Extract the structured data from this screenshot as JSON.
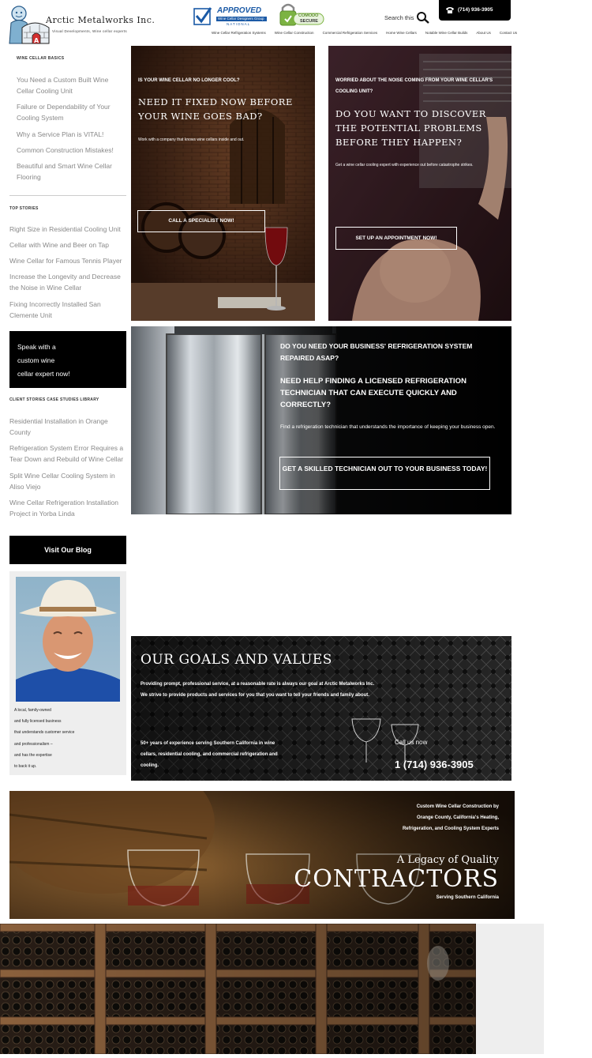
{
  "header": {
    "company_name": "Arctic Metalworks Inc.",
    "tagline": "Visual Developments, Wine cellar experts",
    "approved_badge": {
      "title": "APPROVED",
      "line1": "Wine Cellar Designers Group",
      "line2": "NATIONAL"
    },
    "secure_badge": {
      "line1": "COMODO",
      "line2": "SECURE"
    },
    "search_label": "Search this",
    "phone": "(714) 936-3905",
    "nav": [
      "Wine Cellar Refrigeration Systems",
      "Wine Cellar Construction",
      "Commercial Refrigeration Services",
      "Home Wine Cellars",
      "Notable Wine Cellar Builds",
      "About Us",
      "Contact Us"
    ]
  },
  "sidebar": {
    "basics_heading": "WINE CELLAR BASICS",
    "basics": [
      "You Need a Custom Built Wine Cellar Cooling Unit",
      "Failure or Dependability of Your Cooling System",
      "Why a Service Plan is VITAL!",
      "Common Construction Mistakes!",
      "Beautiful and Smart Wine Cellar Flooring"
    ],
    "top_heading": "TOP STORIES",
    "top": [
      "Right Size in Residential Cooling Unit",
      "Cellar with Wine and Beer on Tap",
      "Wine Cellar for Famous Tennis Player",
      "Increase the Longevity and Decrease the Noise in Wine Cellar",
      "Fixing Incorrectly Installed San Clemente Unit"
    ],
    "speak_lines": [
      "Speak with a",
      "custom wine",
      "cellar expert now!"
    ],
    "library_heading": "CLIENT STORIES CASE STUDIES LIBRARY",
    "library": [
      "Residential Installation in Orange County",
      "Refrigeration System Error Requires a Tear Down and Rebuild of Wine Cellar",
      "Split Wine Cellar Cooling System in Aliso Viejo",
      "Wine Cellar Refrigeration Installation Project in Yorba Linda"
    ],
    "blog_button": "Visit Our Blog",
    "owner_caption": [
      "A local, family-owned",
      "and fully licensed business",
      "that understands customer service",
      "and professionalism –",
      "and has the expertise",
      "to back it up."
    ]
  },
  "panel1": {
    "question": "IS YOUR WINE CELLAR NO LONGER COOL?",
    "headline": "NEED IT FIXED NOW BEFORE YOUR WINE GOES BAD?",
    "body": "Work with a company that knows wine cellars inside and out.",
    "button": "CALL A SPECIALIST NOW!"
  },
  "panel2": {
    "question": "WORRIED ABOUT THE NOISE COMING FROM YOUR WINE CELLAR'S COOLING UNIT?",
    "headline": "DO YOU WANT TO DISCOVER THE POTENTIAL PROBLEMS BEFORE THEY HAPPEN?",
    "body": "Get a wine cellar cooling expert with experience out before catastrophe strikes.",
    "button": "SET UP AN APPOINTMENT NOW!"
  },
  "panel3": {
    "question": "DO YOU NEED YOUR BUSINESS' REFRIGERATION SYSTEM REPAIRED ASAP?",
    "headline": "NEED HELP FINDING A LICENSED REFRIGERATION TECHNICIAN THAT CAN EXECUTE QUICKLY AND CORRECTLY?",
    "body": "Find a refrigeration technician that understands the importance of keeping your business open.",
    "button": "GET A SKILLED TECHNICIAN OUT TO YOUR BUSINESS TODAY!"
  },
  "goals": {
    "title": "OUR GOALS AND VALUES",
    "line1": "Providing prompt, professional service, at a reasonable rate is always our goal at Arctic Metalworks Inc.",
    "line2": "We strive to provide products and services for you that you want to tell your friends and family about.",
    "experience": "50+ years of experience serving Southern California in wine cellars, residential cooling, and commercial refrigeration and cooling.",
    "call_label": "Call us now",
    "call_number": "1 (714) 936-3905"
  },
  "legacy": {
    "intro_lines": [
      "Custom Wine Cellar Construction by",
      "Orange County, California's Heating,",
      "Refrigeration, and Cooling System Experts"
    ],
    "subtitle": "A Legacy of Quality",
    "title": "CONTRACTORS",
    "serving": "Serving Southern California"
  },
  "colors": {
    "black": "#000000",
    "sidebar_link": "#888888",
    "panel_gray": "#3a3a3a"
  }
}
